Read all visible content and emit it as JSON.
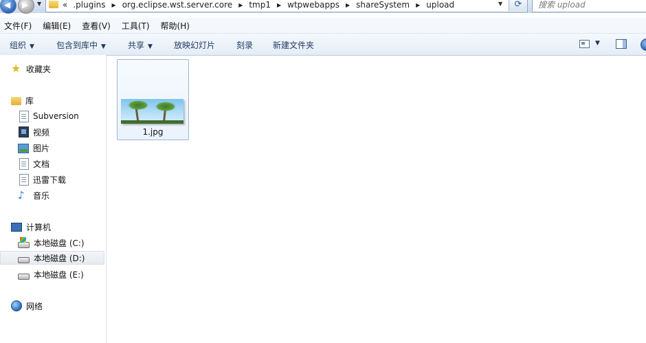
{
  "address_bar": {
    "overflow_marker": "«",
    "breadcrumbs": [
      ".plugins",
      "org.eclipse.wst.server.core",
      "tmp1",
      "wtpwebapps",
      "shareSystem",
      "upload"
    ],
    "search_placeholder": "搜索 upload"
  },
  "menu": {
    "items": [
      "文件(F)",
      "编辑(E)",
      "查看(V)",
      "工具(T)",
      "帮助(H)"
    ]
  },
  "toolbar": {
    "organize": "组织",
    "include_in_library": "包含到库中",
    "share": "共享",
    "slideshow": "放映幻灯片",
    "burn": "刻录",
    "new_folder": "新建文件夹"
  },
  "nav": {
    "favorites": "收藏夹",
    "libraries": "库",
    "library_items": [
      "Subversion",
      "视频",
      "图片",
      "文档",
      "迅雷下载",
      "音乐"
    ],
    "computer": "计算机",
    "drives": [
      "本地磁盘 (C:)",
      "本地磁盘 (D:)",
      "本地磁盘 (E:)"
    ],
    "selected_drive": "本地磁盘 (D:)",
    "network": "网络"
  },
  "files": [
    {
      "name": "1.jpg",
      "icon": "image-thumbnail-palm-trees"
    }
  ],
  "colors": {
    "accent": "#1e395b",
    "selection_border": "#9fb4d2"
  }
}
